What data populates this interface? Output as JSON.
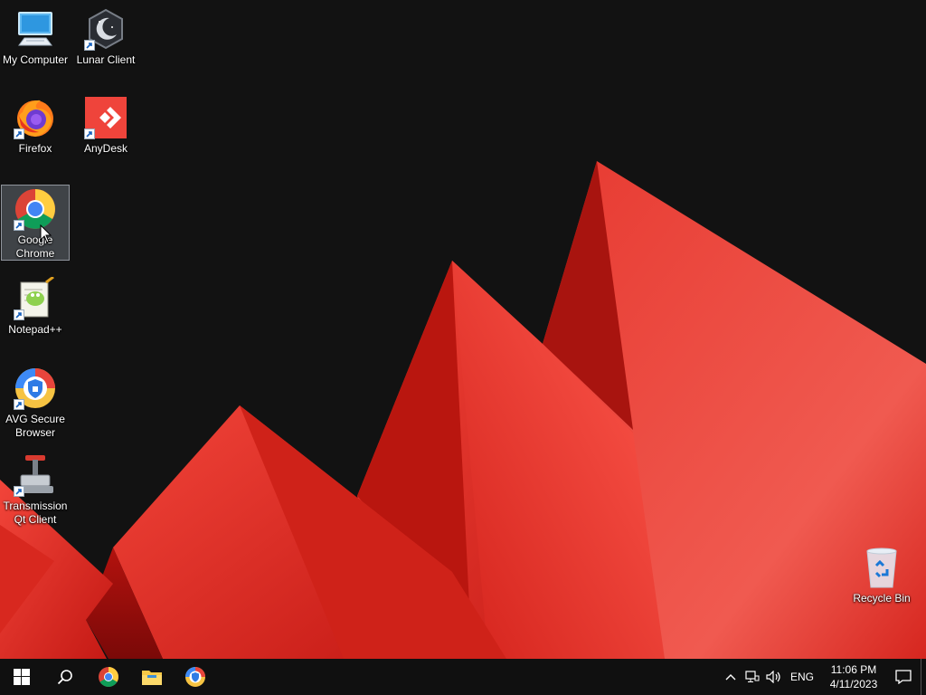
{
  "desktop": {
    "icons": [
      {
        "label": "My Computer",
        "icon": "computer-icon"
      },
      {
        "label": "Lunar Client",
        "icon": "lunar-client-icon"
      },
      {
        "label": "Firefox",
        "icon": "firefox-icon"
      },
      {
        "label": "AnyDesk",
        "icon": "anydesk-icon"
      },
      {
        "label": "Google Chrome",
        "icon": "chrome-icon",
        "selected": true
      },
      {
        "label": "Notepad++",
        "icon": "notepadpp-icon"
      },
      {
        "label": "AVG Secure Browser",
        "icon": "avg-browser-icon"
      },
      {
        "label": "Transmission Qt Client",
        "icon": "transmission-icon"
      },
      {
        "label": "Recycle Bin",
        "icon": "recycle-bin-icon"
      }
    ]
  },
  "taskbar": {
    "buttons": [
      "start-icon",
      "search-icon",
      "chrome-icon",
      "file-explorer-icon",
      "avg-browser-icon"
    ],
    "tray": {
      "language": "ENG",
      "time": "11:06 PM",
      "date": "4/11/2023",
      "icons": [
        "chevron-up-icon",
        "network-icon",
        "volume-icon",
        "notification-icon"
      ]
    }
  },
  "colors": {
    "background": "#121212",
    "taskbar": "#101010",
    "wallpaper_red": "#e8332b",
    "wallpaper_dark_red": "#9c0e0b"
  }
}
